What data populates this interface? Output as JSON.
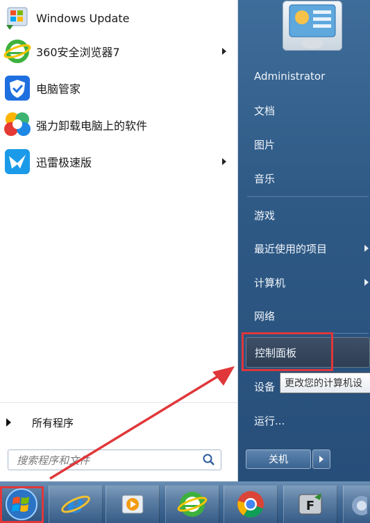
{
  "start_menu": {
    "programs": [
      {
        "label": "Windows Update",
        "icon": "windows-update-icon",
        "has_submenu": false
      },
      {
        "label": "360安全浏览器7",
        "icon": "360-browser-icon",
        "has_submenu": true
      },
      {
        "label": "电脑管家",
        "icon": "pc-manager-icon",
        "has_submenu": false
      },
      {
        "label": "强力卸载电脑上的软件",
        "icon": "uninstaller-icon",
        "has_submenu": false
      },
      {
        "label": "迅雷极速版",
        "icon": "xunlei-icon",
        "has_submenu": true
      }
    ],
    "all_programs_label": "所有程序",
    "search": {
      "placeholder": "搜索程序和文件"
    },
    "right_items": [
      {
        "label": "Administrator",
        "has_submenu": false
      },
      {
        "label": "文档",
        "has_submenu": false
      },
      {
        "label": "图片",
        "has_submenu": false
      },
      {
        "label": "音乐",
        "has_submenu": false
      },
      {
        "label": "游戏",
        "has_submenu": false
      },
      {
        "label": "最近使用的项目",
        "has_submenu": true
      },
      {
        "label": "计算机",
        "has_submenu": true
      },
      {
        "label": "网络",
        "has_submenu": false
      },
      {
        "label": "控制面板",
        "has_submenu": false,
        "highlighted": true
      },
      {
        "label": "设备",
        "has_submenu": false
      },
      {
        "label": "运行...",
        "has_submenu": false
      }
    ],
    "tooltip": "更改您的计算机设",
    "shutdown_label": "关机"
  },
  "taskbar": {
    "items": [
      "start-button",
      "internet-explorer",
      "media-player",
      "360-browser",
      "chrome",
      "flashget",
      "sound"
    ]
  },
  "colors": {
    "annotation_red": "#e0373a",
    "right_pane": "#2f5a86",
    "taskbar": "#456c96"
  }
}
